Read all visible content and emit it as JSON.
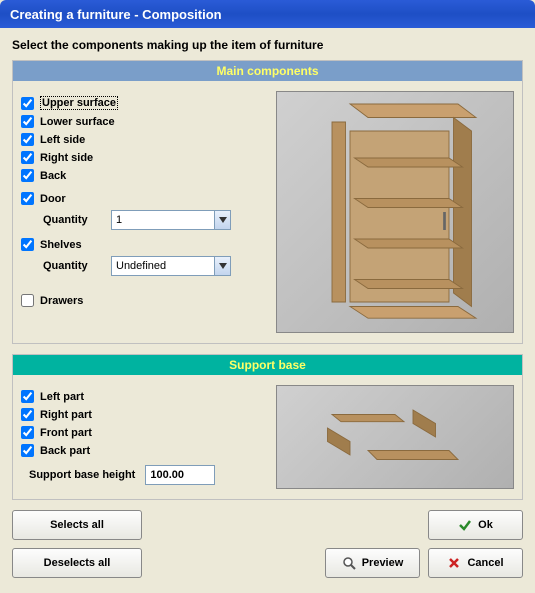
{
  "window": {
    "title": "Creating a furniture - Composition"
  },
  "instruction": "Select the components making up the item of furniture",
  "main": {
    "header": "Main components",
    "upper_surface": {
      "label": "Upper surface",
      "checked": true
    },
    "lower_surface": {
      "label": "Lower surface",
      "checked": true
    },
    "left_side": {
      "label": "Left side",
      "checked": true
    },
    "right_side": {
      "label": "Right side",
      "checked": true
    },
    "back": {
      "label": "Back",
      "checked": true
    },
    "door": {
      "label": "Door",
      "checked": true
    },
    "door_qty_label": "Quantity",
    "door_qty_value": "1",
    "shelves": {
      "label": "Shelves",
      "checked": true
    },
    "shelves_qty_label": "Quantity",
    "shelves_qty_value": "Undefined",
    "drawers": {
      "label": "Drawers",
      "checked": false
    }
  },
  "support": {
    "header": "Support base",
    "left_part": {
      "label": "Left part",
      "checked": true
    },
    "right_part": {
      "label": "Right part",
      "checked": true
    },
    "front_part": {
      "label": "Front part",
      "checked": true
    },
    "back_part": {
      "label": "Back part",
      "checked": true
    },
    "height_label": "Support base height",
    "height_value": "100.00"
  },
  "buttons": {
    "selects_all": "Selects all",
    "deselects_all": "Deselects all",
    "ok": "Ok",
    "preview": "Preview",
    "cancel": "Cancel"
  }
}
